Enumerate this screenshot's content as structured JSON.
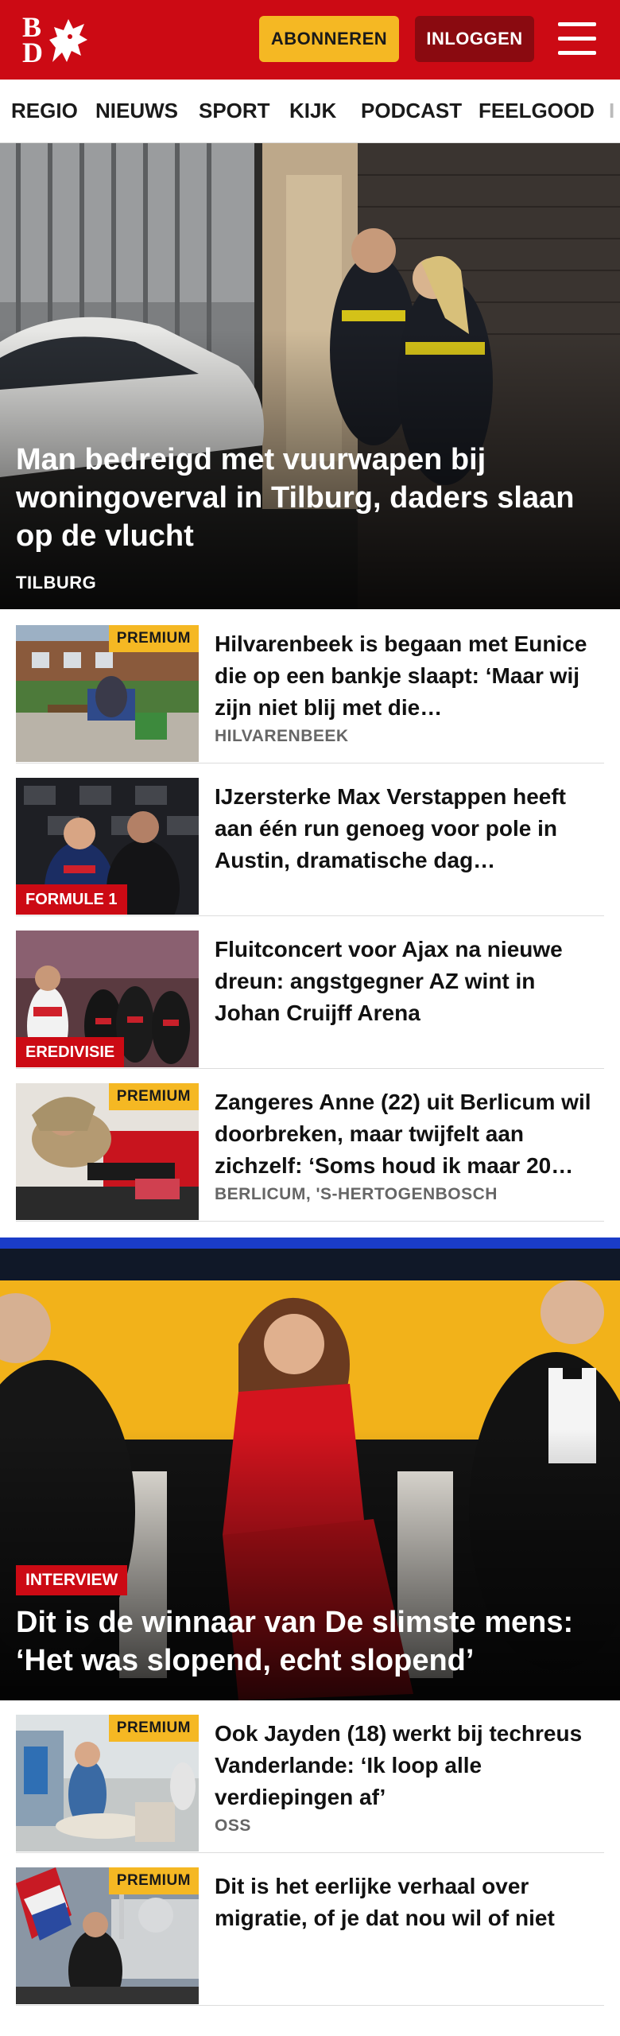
{
  "header": {
    "logo_text": "BD",
    "subscribe_label": "ABONNEREN",
    "login_label": "INLOGGEN",
    "brand_color": "#cc0a14",
    "subscribe_color": "#f5b823"
  },
  "nav": {
    "items": [
      "REGIO",
      "NIEUWS",
      "SPORT",
      "KIJK",
      "PODCAST",
      "FEELGOOD",
      "I"
    ]
  },
  "hero1": {
    "title": "Man bedreigd met vuurwapen bij woningoverval in Tilburg, daders slaan op de vlucht",
    "location": "TILBURG"
  },
  "articles": [
    {
      "title": "Hilvarenbeek is begaan met Eunice die op een bankje slaapt: ‘Maar wij zijn niet blij met die…",
      "badge": "PREMIUM",
      "location": "HILVARENBEEK"
    },
    {
      "title": "IJzersterke Max Verstappen heeft aan één run genoeg voor pole in Austin, dramatische dag…",
      "category": "FORMULE 1"
    },
    {
      "title": "Fluitconcert voor Ajax na nieuwe dreun: angstgegner AZ wint in Johan Cruijff Arena",
      "category": "EREDIVISIE"
    },
    {
      "title": "Zangeres Anne (22) uit Berlicum wil doorbreken, maar twijfelt aan zichzelf: ‘Soms houd ik maar 20…",
      "badge": "PREMIUM",
      "location": "BERLICUM, 'S-HERTOGENBOSCH"
    }
  ],
  "hero2": {
    "category": "INTERVIEW",
    "title": "Dit is de winnaar van De slimste mens: ‘Het was slopend, echt slopend’"
  },
  "articles2": [
    {
      "title": "Ook Jayden (18) werkt bij techreus Vanderlande: ‘Ik loop alle verdiepingen af’",
      "badge": "PREMIUM",
      "location": "OSS"
    },
    {
      "title": "Dit is het eerlijke verhaal over migratie, of je dat nou wil of niet",
      "badge": "PREMIUM"
    }
  ]
}
